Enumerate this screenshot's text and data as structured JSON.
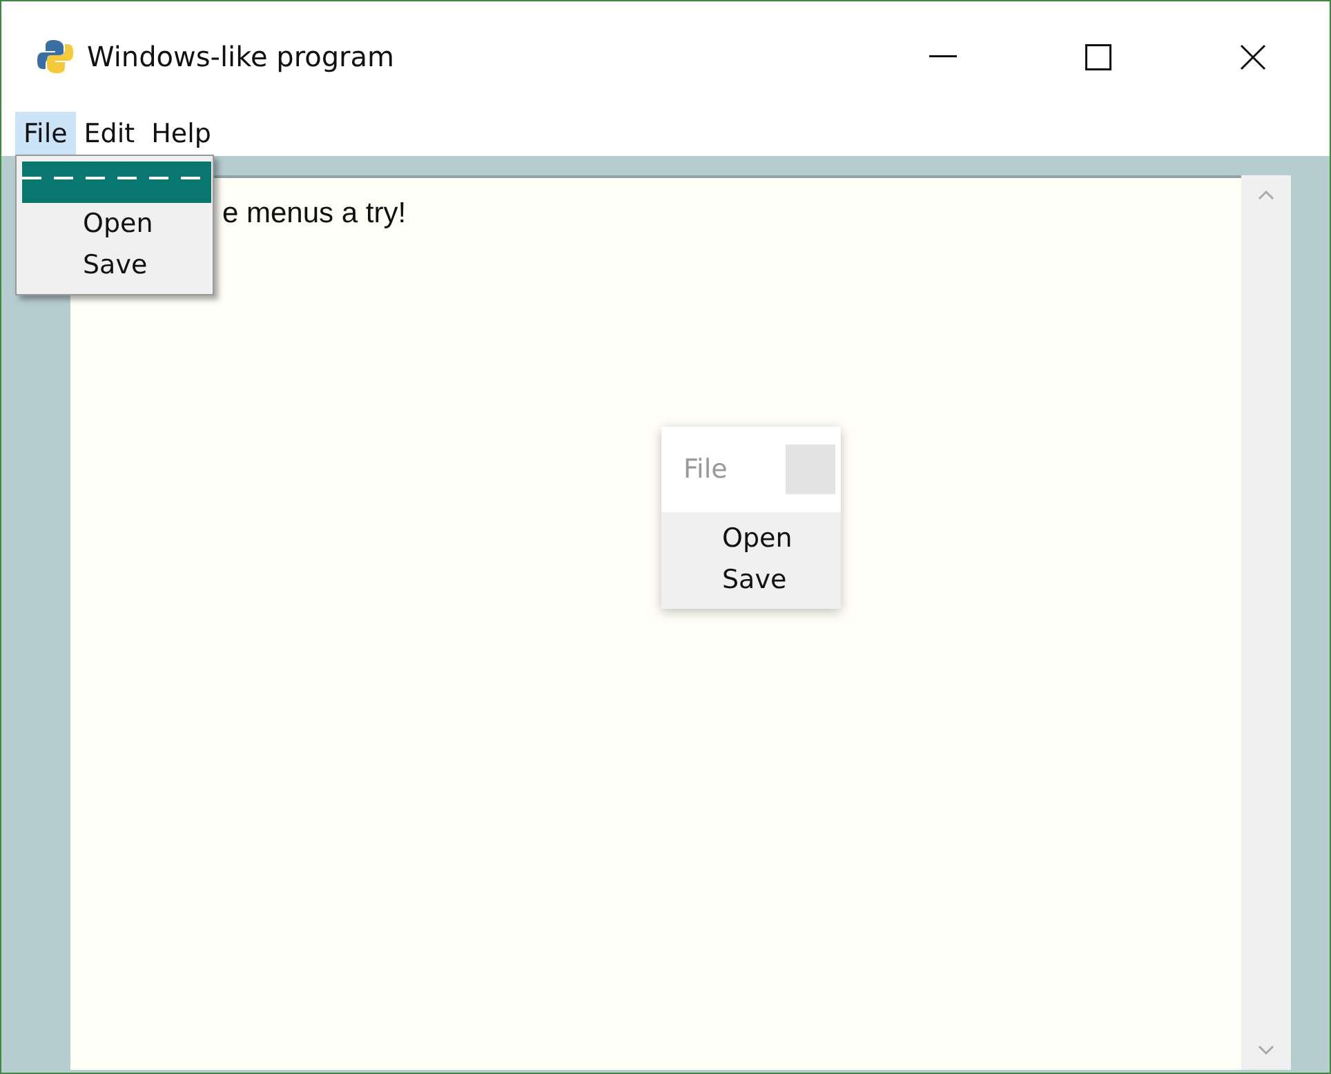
{
  "window": {
    "title": "Windows-like program",
    "controls": [
      {
        "kind": "minimize"
      },
      {
        "kind": "maximize"
      },
      {
        "kind": "close"
      }
    ]
  },
  "menubar": [
    {
      "label": "File",
      "selected": true
    },
    {
      "label": "Edit",
      "selected": false
    },
    {
      "label": "Help",
      "selected": false
    }
  ],
  "dropdown": {
    "items": [
      {
        "kind": "tearoff"
      },
      {
        "kind": "item",
        "label": "Open"
      },
      {
        "kind": "item",
        "label": "Save"
      }
    ]
  },
  "text_area": {
    "value": "e menus a try!"
  },
  "popup_menu": {
    "title": "File",
    "items": [
      {
        "label": "Open"
      },
      {
        "label": "Save"
      }
    ]
  }
}
